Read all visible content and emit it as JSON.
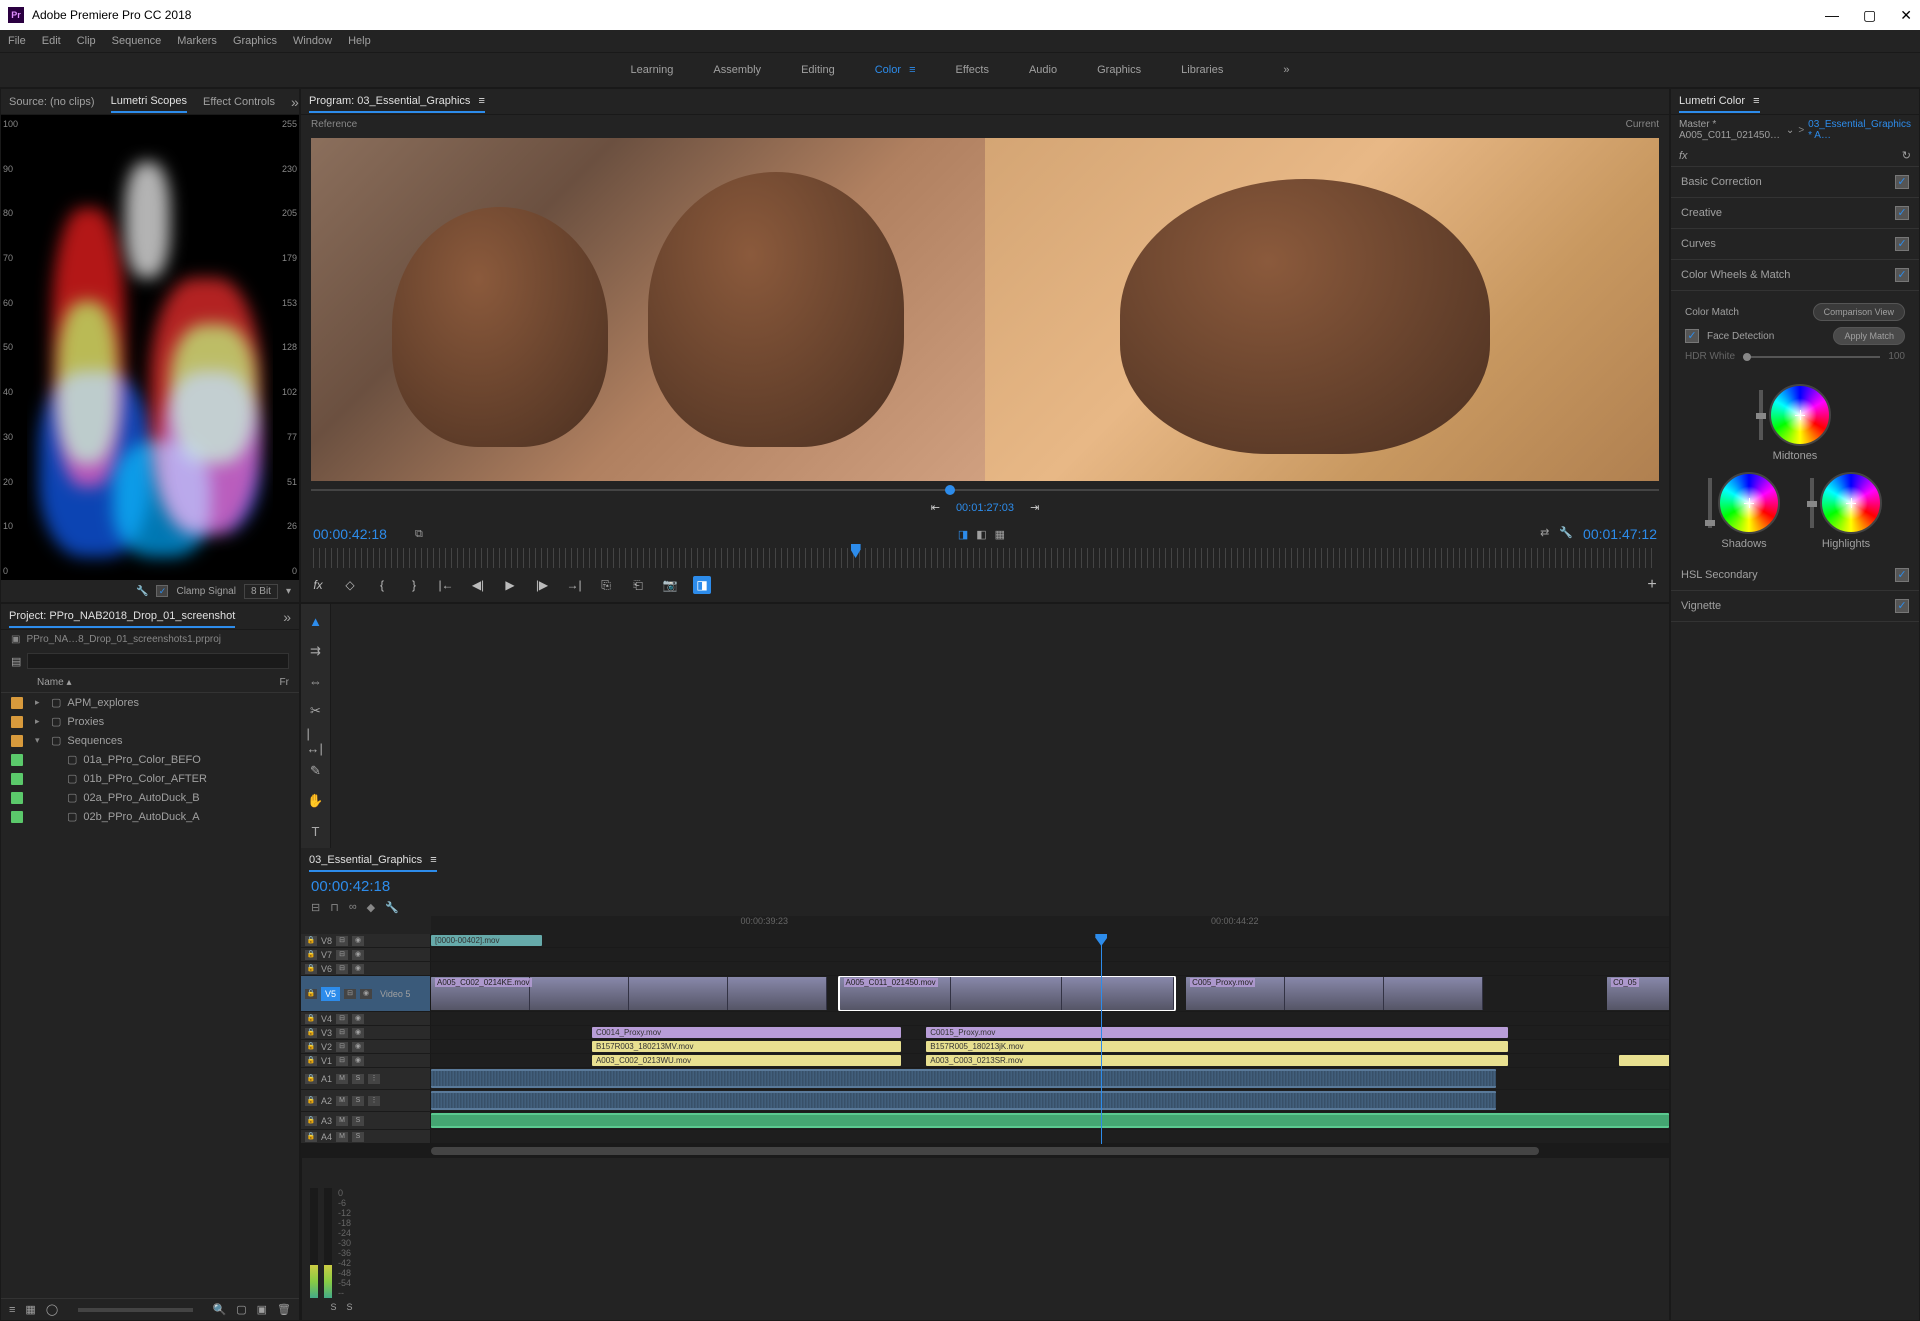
{
  "app": {
    "title": "Adobe Premiere Pro CC 2018",
    "icon": "Pr"
  },
  "menubar": [
    "File",
    "Edit",
    "Clip",
    "Sequence",
    "Markers",
    "Graphics",
    "Window",
    "Help"
  ],
  "workspaces": {
    "tabs": [
      "Learning",
      "Assembly",
      "Editing",
      "Color",
      "Effects",
      "Audio",
      "Graphics",
      "Libraries"
    ],
    "active": "Color"
  },
  "scopes": {
    "tabs": [
      "Source: (no clips)",
      "Lumetri Scopes",
      "Effect Controls"
    ],
    "active": "Lumetri Scopes",
    "left_scale": [
      "100",
      "90",
      "80",
      "70",
      "60",
      "50",
      "40",
      "30",
      "20",
      "10",
      "0"
    ],
    "right_scale": [
      "255",
      "230",
      "205",
      "179",
      "153",
      "128",
      "102",
      "77",
      "51",
      "26",
      "0"
    ],
    "clamp_label": "Clamp Signal",
    "bit_label": "8 Bit"
  },
  "program": {
    "tab": "Program: 03_Essential_Graphics",
    "reference_label": "Reference",
    "current_label": "Current",
    "small_timecode": "00:01:27:03",
    "left_timecode": "00:00:42:18",
    "right_timecode": "00:01:47:12"
  },
  "lumetri": {
    "tab": "Lumetri Color",
    "master": "Master * A005_C011_021450…",
    "sequence": "03_Essential_Graphics * A…",
    "fx": "fx",
    "sections": {
      "basic": "Basic Correction",
      "creative": "Creative",
      "curves": "Curves",
      "wheels": "Color Wheels & Match",
      "hsl": "HSL Secondary",
      "vignette": "Vignette"
    },
    "color_match_label": "Color Match",
    "comparison_btn": "Comparison View",
    "face_detect": "Face Detection",
    "apply_btn": "Apply Match",
    "hdr_label": "HDR White",
    "hdr_value": "100",
    "wheel_labels": {
      "mid": "Midtones",
      "shadows": "Shadows",
      "highlights": "Highlights"
    }
  },
  "project": {
    "tab": "Project: PPro_NAB2018_Drop_01_screenshot",
    "path": "PPro_NA…8_Drop_01_screenshots1.prproj",
    "name_col": "Name",
    "fr_col": "Fr",
    "items": [
      {
        "swatch": "#d89a3c",
        "twisty": "▸",
        "indent": 0,
        "label": "APM_explores"
      },
      {
        "swatch": "#d89a3c",
        "twisty": "▸",
        "indent": 0,
        "label": "Proxies"
      },
      {
        "swatch": "#d89a3c",
        "twisty": "▾",
        "indent": 0,
        "label": "Sequences"
      },
      {
        "swatch": "#5bc96b",
        "twisty": "",
        "indent": 1,
        "label": "01a_PPro_Color_BEFO"
      },
      {
        "swatch": "#5bc96b",
        "twisty": "",
        "indent": 1,
        "label": "01b_PPro_Color_AFTER"
      },
      {
        "swatch": "#5bc96b",
        "twisty": "",
        "indent": 1,
        "label": "02a_PPro_AutoDuck_B"
      },
      {
        "swatch": "#5bc96b",
        "twisty": "",
        "indent": 1,
        "label": "02b_PPro_AutoDuck_A"
      }
    ]
  },
  "timeline": {
    "tab": "03_Essential_Graphics",
    "timecode": "00:00:42:18",
    "ruler": [
      "00:00:39:23",
      "00:00:44:22"
    ],
    "tracks": {
      "v8": "V8",
      "v7": "V7",
      "v6": "V6",
      "v5": "V5",
      "v5_label": "Video 5",
      "v4": "V4",
      "v3": "V3",
      "v2": "V2",
      "v1": "V1",
      "a1": "A1",
      "a2": "A2",
      "a3": "A3",
      "a4": "A4"
    },
    "clips": {
      "green_v8": "[0000-00402].mov",
      "v5_1": "A005_C002_0214KE.mov",
      "v5_2": "A005_C011_021450.mov",
      "v5_3": "C005_Proxy.mov",
      "v5_4": "C0_05",
      "v3": "C0014_Proxy.mov",
      "v3b": "C0015_Proxy.mov",
      "v2": "B157R003_180213MV.mov",
      "v2b": "B157R005_180213jK.mov",
      "v1": "A003_C002_0213WU.mov",
      "v1b": "A003_C003_0213SR.mov"
    },
    "m": "M",
    "s": "S"
  },
  "meters": {
    "scale": [
      "0",
      "-6",
      "-12",
      "-18",
      "-24",
      "-30",
      "-36",
      "-42",
      "-48",
      "-54",
      "--"
    ],
    "solo": "S"
  }
}
